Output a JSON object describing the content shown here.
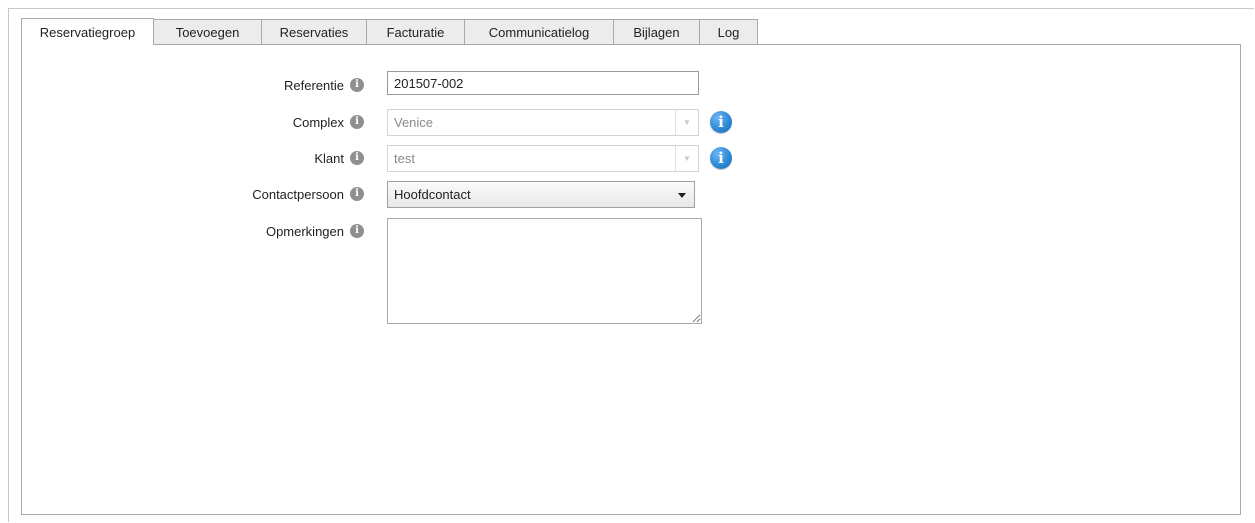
{
  "tabs": [
    {
      "label": "Reservatiegroep",
      "active": true
    },
    {
      "label": "Toevoegen",
      "active": false
    },
    {
      "label": "Reservaties",
      "active": false
    },
    {
      "label": "Facturatie",
      "active": false
    },
    {
      "label": "Communicatielog",
      "active": false
    },
    {
      "label": "Bijlagen",
      "active": false
    },
    {
      "label": "Log",
      "active": false
    }
  ],
  "form": {
    "referentie": {
      "label": "Referentie",
      "value": "201507-002"
    },
    "complex": {
      "label": "Complex",
      "value": "Venice"
    },
    "klant": {
      "label": "Klant",
      "value": "test"
    },
    "contactpersoon": {
      "label": "Contactpersoon",
      "value": "Hoofdcontact"
    },
    "opmerkingen": {
      "label": "Opmerkingen",
      "value": ""
    }
  },
  "icons": {
    "help": "question-info-icon",
    "info": "info-icon"
  },
  "colors": {
    "info_blue": "#2d8ad7",
    "help_grey": "#8f8f8f"
  }
}
